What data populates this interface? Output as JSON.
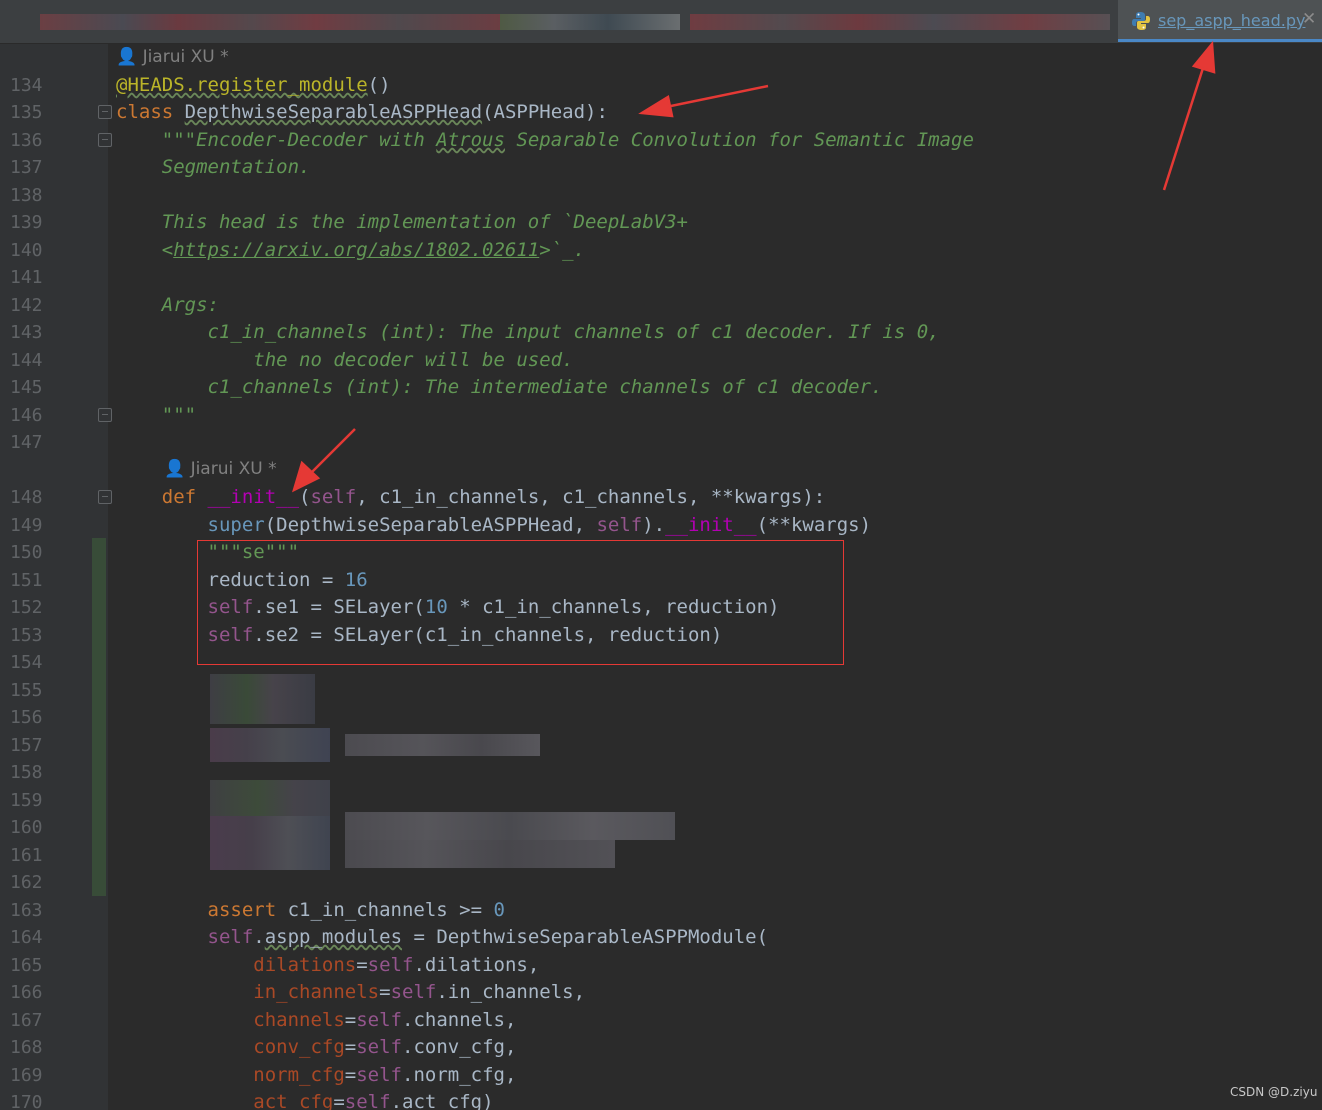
{
  "tabs": {
    "active_label": "sep_aspp_head.py",
    "close_glyph": "✕",
    "active_icon": "python-file-icon"
  },
  "author": {
    "label_1": "👤 Jiarui XU *",
    "label_2": "👤 Jiarui XU *"
  },
  "line_numbers": [
    "134",
    "135",
    "136",
    "137",
    "138",
    "139",
    "140",
    "141",
    "142",
    "143",
    "144",
    "145",
    "146",
    "147",
    "148",
    "149",
    "150",
    "151",
    "152",
    "153",
    "154",
    "155",
    "156",
    "157",
    "158",
    "159",
    "160",
    "161",
    "162",
    "163",
    "164",
    "165",
    "166",
    "167",
    "168",
    "169",
    "170"
  ],
  "code": {
    "l134_dec": "@HEADS.register_module",
    "l134_paren": "()",
    "l135_kw": "class ",
    "l135_name": "DepthwiseSeparableASPPHead",
    "l135_rest": "(ASPPHead):",
    "l136_a": "    \"\"\"Encoder-Decoder with ",
    "l136_b": "Atrous",
    "l136_c": " Separable Convolution for Semantic Image",
    "l137": "    Segmentation.",
    "l139": "    This head is the implementation of `DeepLabV3+",
    "l140_a": "    <",
    "l140_url": "https://arxiv.org/abs/1802.02611",
    "l140_b": ">`_.",
    "l142": "    Args:",
    "l143": "        c1_in_channels (int): The input channels of c1 decoder. If is 0,",
    "l144": "            the no decoder will be used.",
    "l145": "        c1_channels (int): The intermediate channels of c1 decoder.",
    "l146": "    \"\"\"",
    "l148_kw": "    def ",
    "l148_init": "__init__",
    "l148_a": "(",
    "l148_self": "self",
    "l148_b": ", c1_in_channels, c1_channels, **kwargs):",
    "l149_super": "        super",
    "l149_a": "(DepthwiseSeparableASPPHead, ",
    "l149_self": "self",
    "l149_b": ").",
    "l149_init": "__init__",
    "l149_c": "(**kwargs)",
    "l150": "        \"\"\"se\"\"\"",
    "l151_a": "        reduction = ",
    "l151_num": "16",
    "l152_self": "        self",
    "l152_a": ".se1 = SELayer(",
    "l152_num": "10",
    "l152_b": " * c1_in_channels, reduction)",
    "l153_self": "        self",
    "l153_a": ".se2 = SELayer(c1_in_channels, reduction)",
    "l163_kw": "        assert",
    "l163_a": " c1_in_channels >= ",
    "l163_num": "0",
    "l164_self": "        self",
    "l164_a": ".",
    "l164_b": "aspp_modules",
    "l164_c": " = DepthwiseSeparableASPPModule(",
    "l165_p": "            dilations",
    "l165_self": "self",
    "l165_a": ".dilations,",
    "l166_p": "            in_channels",
    "l166_self": "self",
    "l166_a": ".in_channels,",
    "l167_p": "            channels",
    "l167_self": "self",
    "l167_a": ".channels,",
    "l168_p": "            conv_cfg",
    "l168_self": "self",
    "l168_a": ".conv_cfg,",
    "l169_p": "            norm_cfg",
    "l169_self": "self",
    "l169_a": ".norm_cfg,",
    "l170_p": "            act_cfg",
    "l170_self": "self",
    "l170_a": ".act_cfg)",
    "eq": "="
  },
  "watermark": "CSDN @D.ziyu",
  "colors": {
    "background": "#2b2b2b",
    "keyword": "#cc7832",
    "docstring": "#629755",
    "self": "#94558d",
    "number": "#6897bb",
    "annotation": "#e53935"
  }
}
